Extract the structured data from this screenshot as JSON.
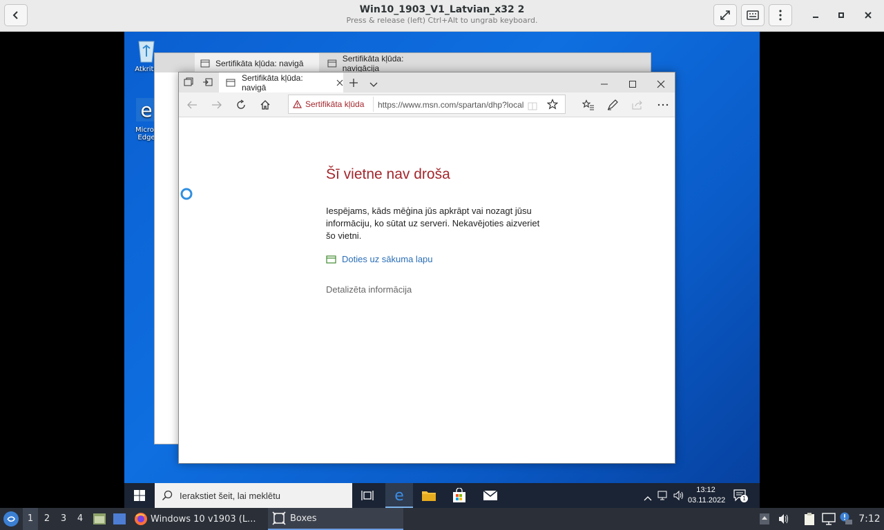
{
  "boxes": {
    "title": "Win10_1903_V1_Latvian_x32 2",
    "subtitle": "Press & release (left) Ctrl+Alt to ungrab keyboard."
  },
  "desktop": {
    "icons": [
      {
        "label": "Atkritn",
        "icon": "recycle-bin-icon"
      },
      {
        "label": "Micros Edge",
        "icon": "edge-icon"
      }
    ]
  },
  "edge_back": {
    "tabs": [
      "Sertifikāta kļūda: navigā",
      "Sertifikāta kļūda: navigācija"
    ]
  },
  "edge": {
    "active_tab": "Sertifikāta kļūda: navigā",
    "cert_error_label": "Sertifikāta kļūda",
    "url": "https://www.msn.com/spartan/dhp?local",
    "error_title": "Šī vietne nav droša",
    "error_body": "Iespējams, kāds mēģina jūs apkrāpt vai nozagt jūsu informāciju, ko sūtat uz serveri. Nekavējoties aizveriet šo vietni.",
    "home_link": "Doties uz sākuma lapu",
    "details_link": "Detalizēta informācija"
  },
  "win_taskbar": {
    "search_placeholder": "Ierakstiet šeit, lai meklētu",
    "time": "13:12",
    "date": "03.11.2022",
    "notification_count": "1"
  },
  "host_taskbar": {
    "workspaces": [
      "1",
      "2",
      "3",
      "4"
    ],
    "tasks": [
      {
        "label": "Windows 10 v1903 (L...",
        "icon": "firefox-icon"
      },
      {
        "label": "Boxes",
        "icon": "boxes-icon"
      }
    ],
    "clock": "7:12"
  },
  "colors": {
    "error_red": "#a4262c",
    "link_blue": "#2a6eb6",
    "desktop_blue": "#0f6fe0"
  }
}
